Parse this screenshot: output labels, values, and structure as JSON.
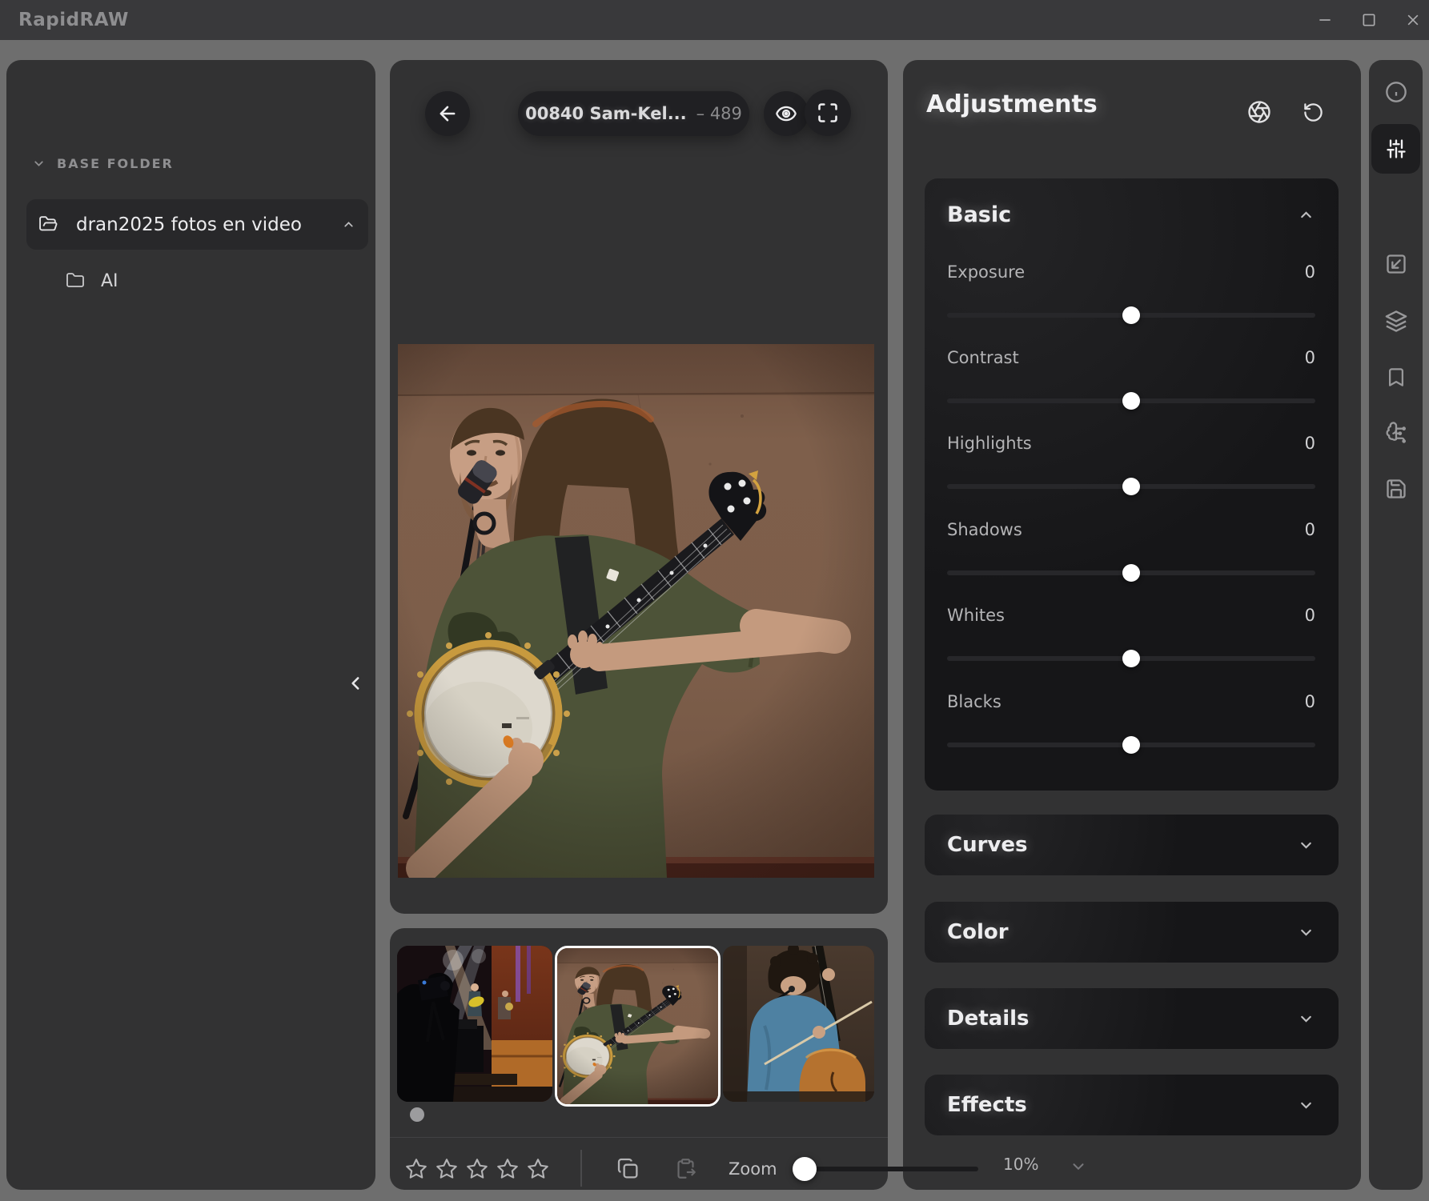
{
  "window": {
    "title": "RapidRAW"
  },
  "sidebar": {
    "header": "BASE FOLDER",
    "root_folder": "dran2025 fotos en video",
    "subfolder": "AI"
  },
  "viewer": {
    "filename": "00840 Sam-Kel...",
    "counter": "– 489"
  },
  "filmstrip": {
    "thumbnails": [
      {
        "selected": false
      },
      {
        "selected": true
      },
      {
        "selected": false
      }
    ],
    "rating_stars": 5,
    "zoom_label": "Zoom",
    "zoom_value": "10%"
  },
  "adjustments": {
    "title": "Adjustments",
    "sections": [
      {
        "name": "Basic",
        "expanded": true,
        "sliders": [
          {
            "label": "Exposure",
            "value": "0"
          },
          {
            "label": "Contrast",
            "value": "0"
          },
          {
            "label": "Highlights",
            "value": "0"
          },
          {
            "label": "Shadows",
            "value": "0"
          },
          {
            "label": "Whites",
            "value": "0"
          },
          {
            "label": "Blacks",
            "value": "0"
          }
        ]
      },
      {
        "name": "Curves"
      },
      {
        "name": "Color"
      },
      {
        "name": "Details"
      },
      {
        "name": "Effects"
      }
    ]
  },
  "rail_icons": [
    "info",
    "adjustments",
    "export",
    "layers",
    "bookmark",
    "ai-tools",
    "save"
  ],
  "colors": {
    "panel": "#323233",
    "card": "#161618",
    "gap": "#6e6e6e",
    "selection": "#ffffff",
    "titlebar": "#39393b"
  }
}
